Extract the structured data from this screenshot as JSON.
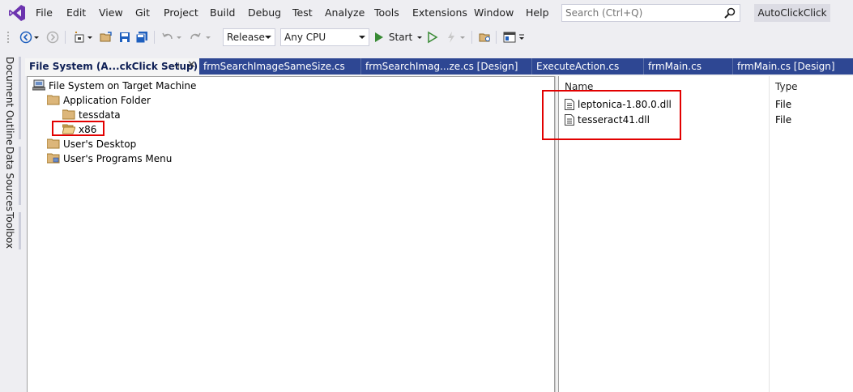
{
  "menu": {
    "items": [
      "File",
      "Edit",
      "View",
      "Git",
      "Project",
      "Build",
      "Debug",
      "Test",
      "Analyze",
      "Tools",
      "Extensions",
      "Window",
      "Help"
    ],
    "search_placeholder": "Search (Ctrl+Q)",
    "solution_name": "AutoClickClick"
  },
  "toolbar": {
    "configuration": "Release",
    "platform": "Any CPU",
    "start_label": "Start"
  },
  "side_tabs": [
    "Document Outline",
    "Data Sources",
    "Toolbox"
  ],
  "tabs": [
    {
      "label": "File System (A...ckClick Setup)",
      "active": true
    },
    {
      "label": "frmSearchImageSameSize.cs"
    },
    {
      "label": "frmSearchImag...ze.cs [Design]"
    },
    {
      "label": "ExecuteAction.cs"
    },
    {
      "label": "frmMain.cs"
    },
    {
      "label": "frmMain.cs [Design]"
    }
  ],
  "tree": {
    "root": "File System on Target Machine",
    "items": [
      {
        "label": "Application Folder",
        "level": 1
      },
      {
        "label": "tessdata",
        "level": 2
      },
      {
        "label": "x86",
        "level": 2,
        "highlighted": true,
        "open": true
      },
      {
        "label": "User's Desktop",
        "level": 1
      },
      {
        "label": "User's Programs Menu",
        "level": 1
      }
    ]
  },
  "list": {
    "columns": [
      "Name",
      "Type"
    ],
    "rows": [
      {
        "name": "leptonica-1.80.0.dll",
        "type": "File"
      },
      {
        "name": "tesseract41.dll",
        "type": "File"
      }
    ]
  },
  "colors": {
    "accent": "#2e4793",
    "highlight_box": "#e20000",
    "folder": "#dcb67a"
  }
}
